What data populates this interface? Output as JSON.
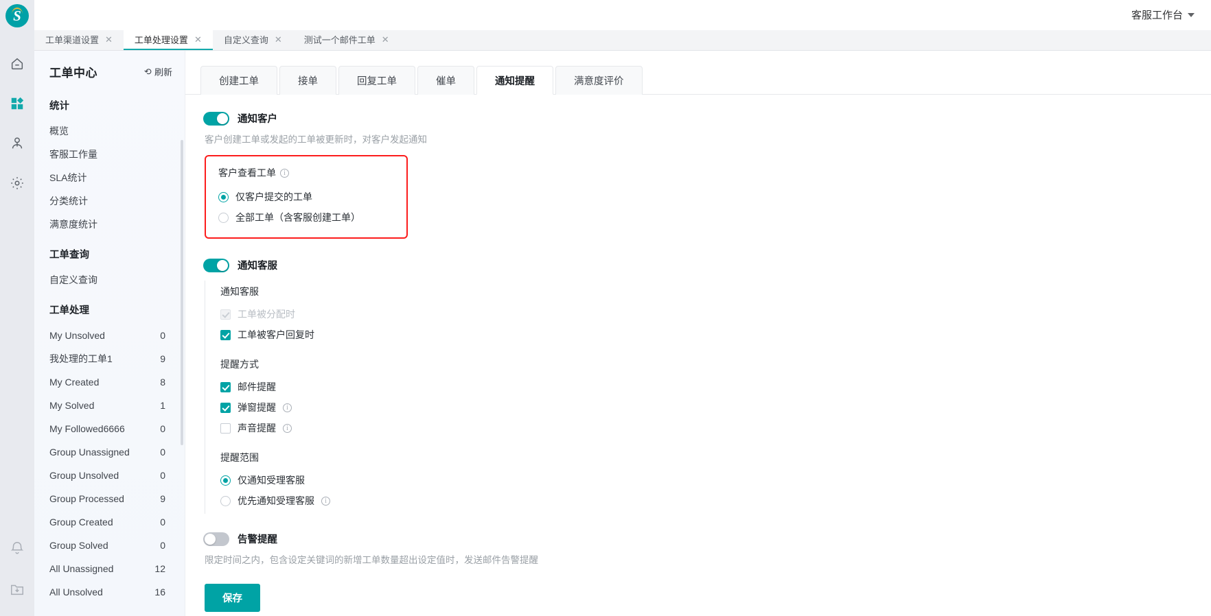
{
  "topbar": {
    "workbench_label": "客服工作台",
    "caret_icon": "chevron-down-icon",
    "logo_letter": "S"
  },
  "rail": {
    "icons": [
      {
        "name": "home-icon",
        "active": false
      },
      {
        "name": "grid-apps-icon",
        "active": true
      },
      {
        "name": "user-icon",
        "active": false
      },
      {
        "name": "gear-icon",
        "active": false
      }
    ],
    "bottom_icons": [
      {
        "name": "bell-icon"
      },
      {
        "name": "download-folder-icon"
      }
    ]
  },
  "window_tabs": [
    {
      "label": "工单渠道设置",
      "active": false,
      "close_icon": "close-icon"
    },
    {
      "label": "工单处理设置",
      "active": true,
      "close_icon": "close-icon"
    },
    {
      "label": "自定义查询",
      "active": false,
      "close_icon": "close-icon"
    },
    {
      "label": "测试一个邮件工单",
      "active": false,
      "close_icon": "close-icon"
    }
  ],
  "sidebar": {
    "title": "工单中心",
    "refresh_label": "刷新",
    "refresh_icon": "refresh-icon",
    "sections": [
      {
        "heading": "统计",
        "items": [
          {
            "label": "概览",
            "count": ""
          },
          {
            "label": "客服工作量",
            "count": ""
          },
          {
            "label": "SLA统计",
            "count": ""
          },
          {
            "label": "分类统计",
            "count": ""
          },
          {
            "label": "满意度统计",
            "count": ""
          }
        ]
      },
      {
        "heading": "工单查询",
        "items": [
          {
            "label": "自定义查询",
            "count": ""
          }
        ]
      },
      {
        "heading": "工单处理",
        "items": [
          {
            "label": "My Unsolved",
            "count": "0"
          },
          {
            "label": "我处理的工单1",
            "count": "9"
          },
          {
            "label": "My Created",
            "count": "8"
          },
          {
            "label": "My Solved",
            "count": "1"
          },
          {
            "label": "My Followed6666",
            "count": "0"
          },
          {
            "label": "Group Unassigned",
            "count": "0"
          },
          {
            "label": "Group Unsolved",
            "count": "0"
          },
          {
            "label": "Group Processed",
            "count": "9"
          },
          {
            "label": "Group Created",
            "count": "0"
          },
          {
            "label": "Group Solved",
            "count": "0"
          },
          {
            "label": "All Unassigned",
            "count": "12"
          },
          {
            "label": "All Unsolved",
            "count": "16"
          }
        ]
      }
    ]
  },
  "main": {
    "tabs": [
      {
        "label": "创建工单",
        "active": false
      },
      {
        "label": "接单",
        "active": false
      },
      {
        "label": "回复工单",
        "active": false
      },
      {
        "label": "催单",
        "active": false
      },
      {
        "label": "通知提醒",
        "active": true
      },
      {
        "label": "满意度评价",
        "active": false
      }
    ],
    "notify_customer": {
      "toggle_label": "通知客户",
      "toggle_on": true,
      "hint": "客户创建工单或发起的工单被更新时，对客户发起通知",
      "highlight_color": "#fc1c1c",
      "field_label": "客户查看工单",
      "field_info_icon": "info-icon",
      "options": [
        {
          "label": "仅客户提交的工单",
          "checked": true
        },
        {
          "label": "全部工单（含客服创建工单）",
          "checked": false
        }
      ]
    },
    "notify_agent": {
      "toggle_label": "通知客服",
      "toggle_on": true,
      "groups": [
        {
          "title": "通知客服",
          "type": "checkbox",
          "items": [
            {
              "label": "工单被分配时",
              "checked": true,
              "disabled": true,
              "info": false
            },
            {
              "label": "工单被客户回复时",
              "checked": true,
              "disabled": false,
              "info": false
            }
          ]
        },
        {
          "title": "提醒方式",
          "type": "checkbox",
          "items": [
            {
              "label": "邮件提醒",
              "checked": true,
              "disabled": false,
              "info": false
            },
            {
              "label": "弹窗提醒",
              "checked": true,
              "disabled": false,
              "info": true
            },
            {
              "label": "声音提醒",
              "checked": false,
              "disabled": false,
              "info": true
            }
          ]
        },
        {
          "title": "提醒范围",
          "type": "radio",
          "items": [
            {
              "label": "仅通知受理客服",
              "checked": true,
              "disabled": false,
              "info": false
            },
            {
              "label": "优先通知受理客服",
              "checked": false,
              "disabled": false,
              "info": true
            }
          ]
        }
      ]
    },
    "alarm": {
      "toggle_label": "告警提醒",
      "toggle_on": false,
      "hint": "限定时间之内，包含设定关键词的新增工单数量超出设定值时，发送邮件告警提醒"
    },
    "save_label": "保存",
    "accent_color": "#00a3a5"
  }
}
